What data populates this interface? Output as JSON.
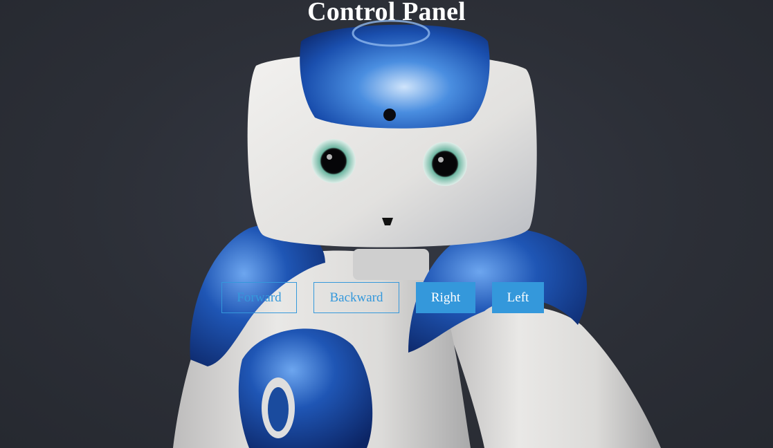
{
  "page": {
    "title": "Control Panel"
  },
  "controls": {
    "forward_label": "Forward",
    "backward_label": "Backward",
    "right_label": "Right",
    "left_label": "Left"
  },
  "colors": {
    "background": "#2c2f37",
    "accent": "#3498db",
    "title_text": "#ffffff"
  },
  "background_image": {
    "subject": "humanoid-robot-icon"
  }
}
